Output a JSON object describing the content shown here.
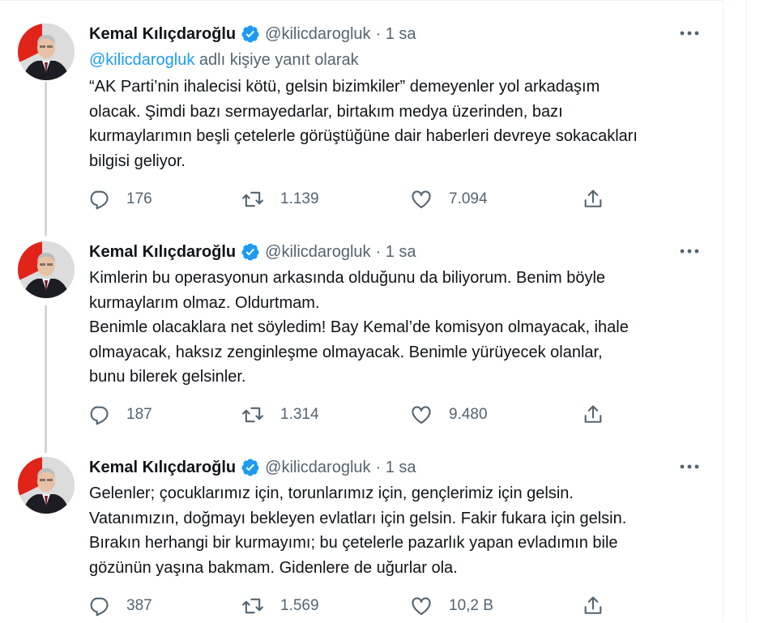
{
  "tweets": [
    {
      "author": "Kemal Kılıçdaroğlu",
      "handle": "@kilicdarogluk",
      "time": "· 1 sa",
      "reply_to": {
        "mention": "@kilicdarogluk",
        "suffix": " adlı kişiye yanıt olarak"
      },
      "text": "“AK Parti’nin ihalecisi kötü, gelsin bizimkiler” demeyenler yol arkadaşım\nolacak. Şimdi bazı sermayedarlar, birtakım medya üzerinden, bazı\nkurmaylarımın beşli çetelerle görüştüğüne dair haberleri devreye sokacakları\nbilgisi geliyor.",
      "replies": "176",
      "retweets": "1.139",
      "likes": "7.094"
    },
    {
      "author": "Kemal Kılıçdaroğlu",
      "handle": "@kilicdarogluk",
      "time": "· 1 sa",
      "text": "Kimlerin bu operasyonun arkasında olduğunu da biliyorum. Benim böyle\nkurmaylarım olmaz. Oldurtmam.\nBenimle olacaklara net söyledim! Bay Kemal’de komisyon olmayacak, ihale\nolmayacak, haksız zenginleşme olmayacak. Benimle yürüyecek olanlar,\nbunu bilerek gelsinler.",
      "replies": "187",
      "retweets": "1.314",
      "likes": "9.480"
    },
    {
      "author": "Kemal Kılıçdaroğlu",
      "handle": "@kilicdarogluk",
      "time": "· 1 sa",
      "text": "Gelenler; çocuklarımız için, torunlarımız için, gençlerimiz için gelsin.\nVatanımızın, doğmayı bekleyen evlatları için gelsin. Fakir fukara için gelsin.\nBırakın herhangi bir kurmayımı; bu çetelerle pazarlık yapan evladımın bile\ngözünün yaşına bakmam. Gidenlere de uğurlar ola.",
      "replies": "387",
      "retweets": "1.569",
      "likes": "10,2 B"
    }
  ],
  "icons": {
    "verified": "verified-badge-icon",
    "more": "more-horizontal-icon",
    "reply": "reply-icon",
    "retweet": "retweet-icon",
    "like": "heart-icon",
    "share": "share-icon"
  },
  "colors": {
    "verified": "#1d9bf0",
    "mention": "#1d9bf0",
    "secondary_text": "#536471",
    "thread_line": "#cfd9de"
  }
}
